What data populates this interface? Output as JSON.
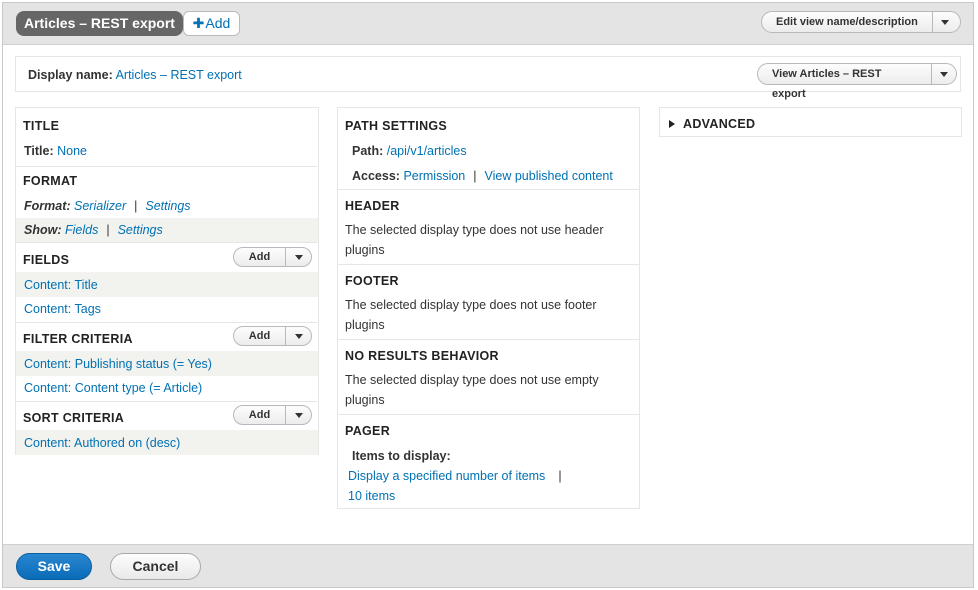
{
  "topbar": {
    "display_tab": "Articles – REST export",
    "add_display_plus": "✚",
    "add_display_label": "Add",
    "edit_name_label": "Edit view name/description"
  },
  "display_name": {
    "label": "Display name:",
    "value": "Articles – REST export",
    "view_button": "View Articles – REST export"
  },
  "col1": {
    "title": {
      "heading": "TITLE",
      "label": "Title:",
      "value": "None"
    },
    "format": {
      "heading": "FORMAT",
      "format_label": "Format:",
      "format_value": "Serializer",
      "format_settings": "Settings",
      "show_label": "Show:",
      "show_value": "Fields",
      "show_settings": "Settings",
      "separator": "|"
    },
    "fields": {
      "heading": "FIELDS",
      "add_label": "Add",
      "items": [
        "Content: Title",
        "Content: Tags"
      ]
    },
    "filter": {
      "heading": "FILTER CRITERIA",
      "add_label": "Add",
      "items": [
        "Content: Publishing status (= Yes)",
        "Content: Content type (= Article)"
      ]
    },
    "sort": {
      "heading": "SORT CRITERIA",
      "add_label": "Add",
      "items": [
        "Content: Authored on (desc)"
      ]
    }
  },
  "col2": {
    "path": {
      "heading": "PATH SETTINGS",
      "path_label": "Path:",
      "path_value": "/api/v1/articles",
      "access_label": "Access:",
      "access_value": "Permission",
      "separator": "|",
      "access_extra": "View published content"
    },
    "header": {
      "heading": "HEADER",
      "text": "The selected display type does not use header plugins"
    },
    "footer": {
      "heading": "FOOTER",
      "text": "The selected display type does not use footer plugins"
    },
    "no_results": {
      "heading": "NO RESULTS BEHAVIOR",
      "text": "The selected display type does not use empty plugins"
    },
    "pager": {
      "heading": "PAGER",
      "items_label": "Items to display:",
      "mode": "Display a specified number of items",
      "separator": "|",
      "count": "10 items"
    }
  },
  "col3": {
    "advanced": "ADVANCED"
  },
  "actions": {
    "save": "Save",
    "cancel": "Cancel"
  },
  "colors": {
    "link": "#0071b3",
    "primary_button": "#0a6bb8",
    "bar_background": "#e4e4e4",
    "band_background": "#f2f2ef"
  }
}
